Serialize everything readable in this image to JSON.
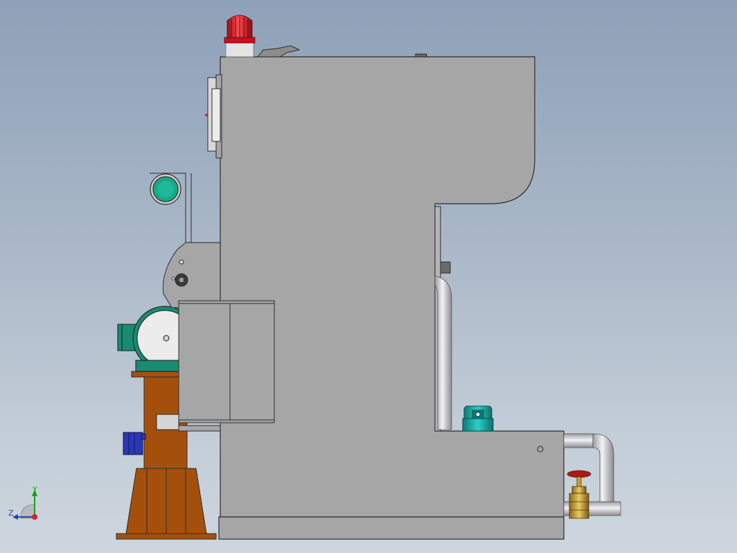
{
  "triad": {
    "y_label": "Y",
    "z_label": "Z"
  },
  "colors": {
    "background_top": "#8ea1b8",
    "background_bottom": "#cdd6de",
    "frame": "#a6a6a6",
    "frame_edge": "#2b2b2b",
    "stand": "#a4500c",
    "warning_light": "#d81e2c",
    "pump": "#1fb8b0",
    "motor": "#1a8a70",
    "gauge": "#1aa884",
    "solenoid": "#2838b8",
    "valve_handle": "#b01818",
    "valve_body": "#c8a03c",
    "pipe": "#c8c8cc"
  },
  "icons": {
    "warning_light": "beacon-light-icon",
    "valve": "gate-valve-icon",
    "pump": "oil-pump-icon",
    "motor": "electric-motor-icon",
    "gauge": "pressure-gauge-icon",
    "triad": "coordinate-triad-icon"
  }
}
